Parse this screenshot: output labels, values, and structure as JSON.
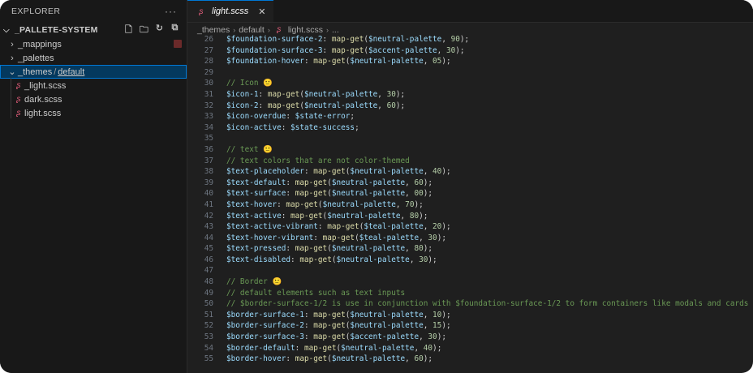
{
  "sidebar": {
    "title": "EXPLORER",
    "more": "···",
    "root": "_PALLETE-SYSTEM",
    "actions": [
      "new-file-icon",
      "new-folder-icon",
      "refresh-icon",
      "collapse-all-icon"
    ],
    "folders": [
      {
        "name": "_mappings"
      },
      {
        "name": "_palettes"
      }
    ],
    "selected_folder": {
      "name": "_themes",
      "sep": "/",
      "sub": "default"
    },
    "files": [
      "_light.scss",
      "dark.scss",
      "light.scss"
    ]
  },
  "tab": {
    "label": "light.scss",
    "close": "✕"
  },
  "breadcrumb": [
    "_themes",
    "default",
    "light.scss",
    "..."
  ],
  "colors": {
    "accent": "#0078d4",
    "sass": "#e05d7a",
    "comment": "#6a9955",
    "variable": "#9cdcfe",
    "function": "#dcdcaa",
    "number": "#b5cea8"
  },
  "code_lines": [
    {
      "n": "26",
      "text": "$foundation-surface-2: map-get($neutral-palette, 90);"
    },
    {
      "n": "27",
      "text": "$foundation-surface-3: map-get($accent-palette, 30);"
    },
    {
      "n": "28",
      "text": "$foundation-hover: map-get($neutral-palette, 05);"
    },
    {
      "n": "29",
      "text": ""
    },
    {
      "n": "30",
      "text": "// Icon 🙂"
    },
    {
      "n": "31",
      "text": "$icon-1: map-get($neutral-palette, 30);"
    },
    {
      "n": "32",
      "text": "$icon-2: map-get($neutral-palette, 60);"
    },
    {
      "n": "33",
      "text": "$icon-overdue: $state-error;"
    },
    {
      "n": "34",
      "text": "$icon-active: $state-success;"
    },
    {
      "n": "35",
      "text": ""
    },
    {
      "n": "36",
      "text": "// text 🙂"
    },
    {
      "n": "37",
      "text": "// text colors that are not color-themed"
    },
    {
      "n": "38",
      "text": "$text-placeholder: map-get($neutral-palette, 40);"
    },
    {
      "n": "39",
      "text": "$text-default: map-get($neutral-palette, 60);"
    },
    {
      "n": "40",
      "text": "$text-surface: map-get($neutral-palette, 00);"
    },
    {
      "n": "41",
      "text": "$text-hover: map-get($neutral-palette, 70);"
    },
    {
      "n": "42",
      "text": "$text-active: map-get($neutral-palette, 80);"
    },
    {
      "n": "43",
      "text": "$text-active-vibrant: map-get($teal-palette, 20);"
    },
    {
      "n": "44",
      "text": "$text-hover-vibrant: map-get($teal-palette, 30);"
    },
    {
      "n": "45",
      "text": "$text-pressed: map-get($neutral-palette, 80);"
    },
    {
      "n": "46",
      "text": "$text-disabled: map-get($neutral-palette, 30);"
    },
    {
      "n": "47",
      "text": ""
    },
    {
      "n": "48",
      "text": "// Border 🙂"
    },
    {
      "n": "49",
      "text": "// default elements such as text inputs"
    },
    {
      "n": "50",
      "text": "// $border-surface-1/2 is use in conjunction with $foundation-surface-1/2 to form containers like modals and cards"
    },
    {
      "n": "51",
      "text": "$border-surface-1: map-get($neutral-palette, 10);"
    },
    {
      "n": "52",
      "text": "$border-surface-2: map-get($neutral-palette, 15);"
    },
    {
      "n": "53",
      "text": "$border-surface-3: map-get($accent-palette, 30);"
    },
    {
      "n": "54",
      "text": "$border-default: map-get($neutral-palette, 40);"
    },
    {
      "n": "55",
      "text": "$border-hover: map-get($neutral-palette, 60);"
    }
  ]
}
